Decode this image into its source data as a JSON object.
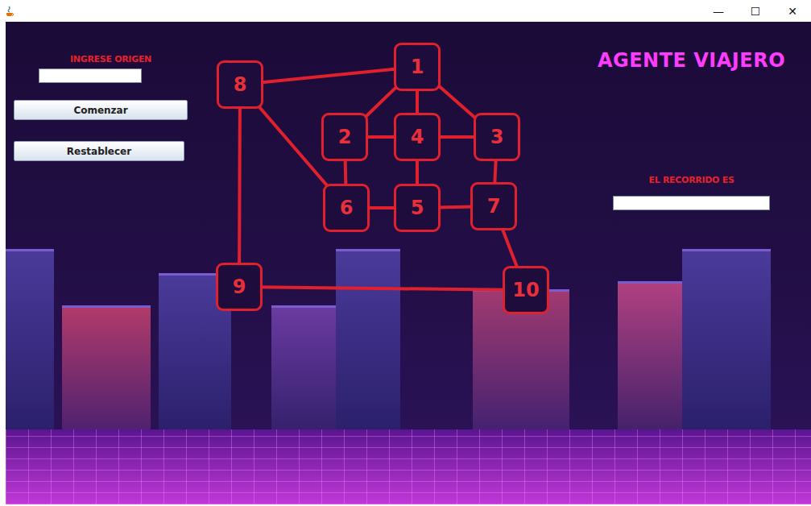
{
  "window": {
    "title": "",
    "controls": [
      "—",
      "☐",
      "✕"
    ]
  },
  "origin": {
    "label": "INGRESE ORIGEN",
    "value": ""
  },
  "buttons": [
    "Comenzar",
    "Restablecer"
  ],
  "app_title": "AGENTE VIAJERO",
  "result": {
    "label": "EL RECORRIDO ES",
    "value": ""
  },
  "graph": {
    "nodes": [
      {
        "label": "1"
      },
      {
        "label": "2"
      },
      {
        "label": "3"
      },
      {
        "label": "4"
      },
      {
        "label": "5"
      },
      {
        "label": "6"
      },
      {
        "label": "7"
      },
      {
        "label": "8"
      },
      {
        "label": "9"
      },
      {
        "label": "10"
      }
    ],
    "edges": [
      [
        "1",
        "2"
      ],
      [
        "1",
        "4"
      ],
      [
        "1",
        "3"
      ],
      [
        "2",
        "4"
      ],
      [
        "4",
        "3"
      ],
      [
        "2",
        "6"
      ],
      [
        "4",
        "5"
      ],
      [
        "3",
        "7"
      ],
      [
        "6",
        "5"
      ],
      [
        "5",
        "7"
      ],
      [
        "8",
        "1"
      ],
      [
        "8",
        "6"
      ],
      [
        "8",
        "9"
      ],
      [
        "9",
        "10"
      ],
      [
        "7",
        "10"
      ]
    ]
  }
}
